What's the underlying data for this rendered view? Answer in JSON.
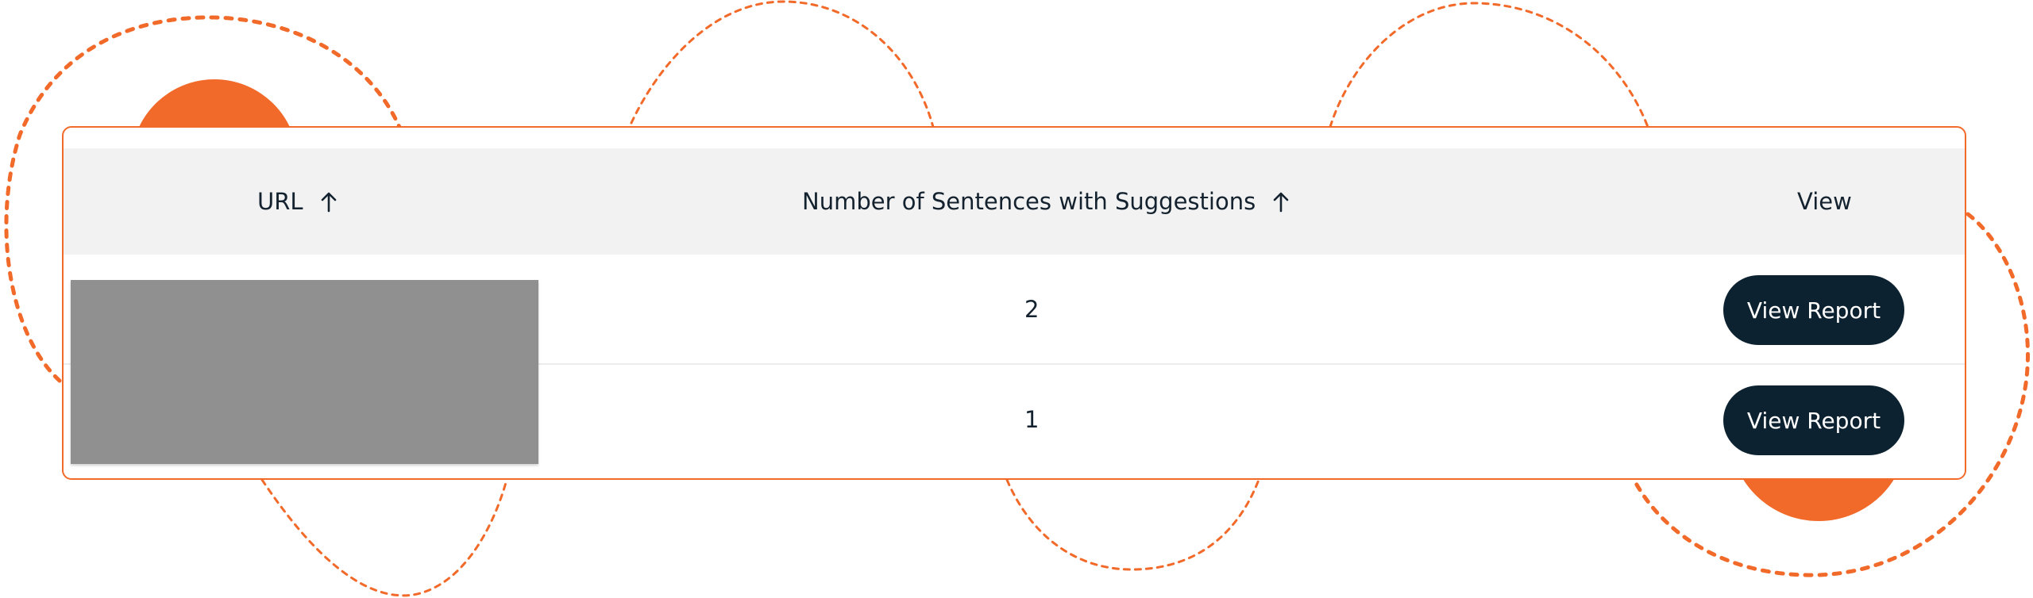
{
  "colors": {
    "accent": "#f26a2a",
    "header_bg": "#f2f2f2",
    "button_bg": "#0d2230",
    "text": "#13222e",
    "redaction": "#909090"
  },
  "table": {
    "columns": [
      {
        "label": "URL",
        "sortable": true,
        "sort_icon": "arrow-up-icon"
      },
      {
        "label": "Number of Sentences with Suggestions",
        "sortable": true,
        "sort_icon": "arrow-up-icon"
      },
      {
        "label": "View",
        "sortable": false
      }
    ],
    "rows": [
      {
        "url": "",
        "count": "2",
        "action": "View Report"
      },
      {
        "url": "",
        "count": "1",
        "action": "View Report"
      }
    ],
    "url_cells_redacted": true
  }
}
